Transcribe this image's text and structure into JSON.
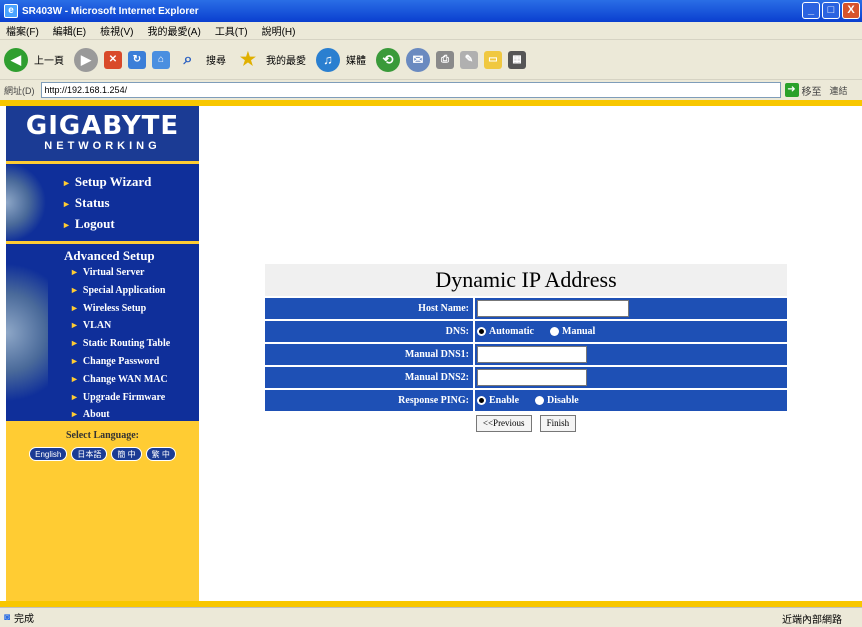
{
  "window": {
    "title": "SR403W - Microsoft Internet Explorer",
    "buttons": [
      "_",
      "□",
      "X"
    ]
  },
  "menubar": [
    "檔案(F)",
    "編輯(E)",
    "檢視(V)",
    "我的最愛(A)",
    "工具(T)",
    "說明(H)"
  ],
  "toolbar": {
    "back_label": "上一頁",
    "search_label": "搜尋",
    "favorites_label": "我的最愛",
    "media_label": "媒體"
  },
  "address": {
    "label": "網址(D)",
    "url": "http://192.168.1.254/",
    "go_label": "移至",
    "links_label": "連結"
  },
  "brand": {
    "logo_big": "GIGABYTE",
    "logo_small": "NETWORKING"
  },
  "nav_main": [
    "Setup Wizard",
    "Status",
    "Logout"
  ],
  "nav_advanced": {
    "heading": "Advanced Setup",
    "items": [
      "Virtual Server",
      "Special Application",
      "Wireless Setup",
      "VLAN",
      "Static Routing Table",
      "Change Password",
      "Change WAN MAC",
      "Upgrade Firmware",
      "About"
    ]
  },
  "language": {
    "label": "Select Language:",
    "options": [
      "English",
      "日本語",
      "簡 中",
      "繁 中"
    ]
  },
  "form": {
    "title": "Dynamic IP Address",
    "host_name_label": "Host Name:",
    "dns_label": "DNS:",
    "dns_auto": "Automatic",
    "dns_manual": "Manual",
    "manual_dns1_label": "Manual DNS1:",
    "manual_dns2_label": "Manual DNS2:",
    "ping_label": "Response PING:",
    "ping_enable": "Enable",
    "ping_disable": "Disable",
    "previous_button": "<<Previous",
    "finish_button": "Finish"
  },
  "status": {
    "left": "完成",
    "right": "近端內部網路"
  }
}
